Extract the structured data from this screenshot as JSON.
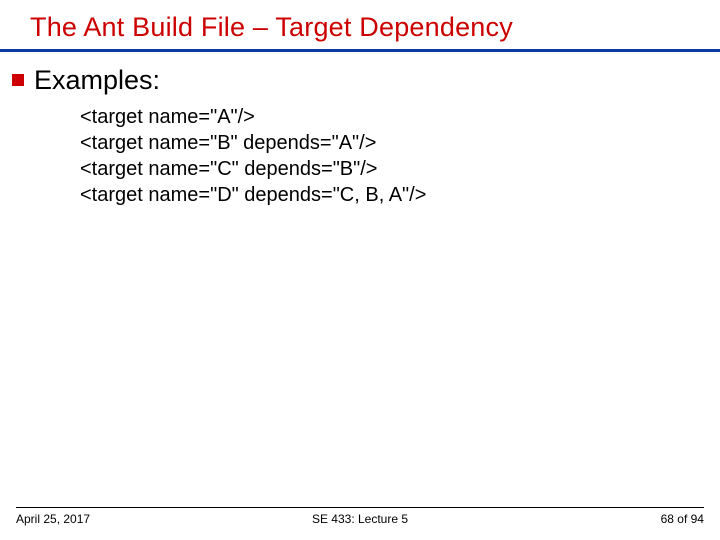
{
  "title": "The Ant Build File – Target Dependency",
  "bullet": {
    "label": "Examples:"
  },
  "code": {
    "line1": "<target name=\"A\"/>",
    "line2": "<target name=\"B\" depends=\"A\"/>",
    "line3": "<target name=\"C\" depends=\"B\"/>",
    "line4": "<target name=\"D\" depends=\"C, B, A\"/>"
  },
  "footer": {
    "date": "April 25, 2017",
    "course": "SE 433: Lecture 5",
    "page": "68 of 94"
  }
}
